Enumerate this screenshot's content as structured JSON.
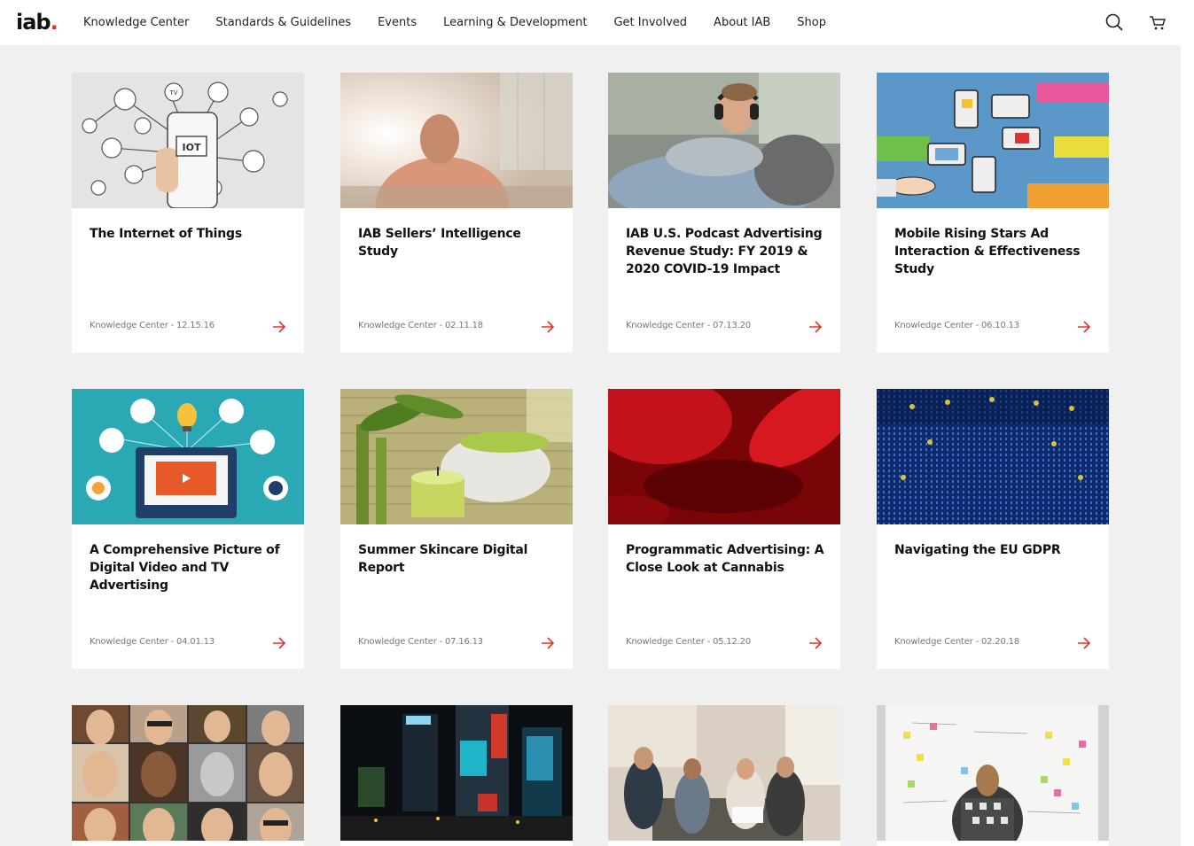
{
  "header": {
    "logo_text": "iab",
    "logo_dot": ".",
    "nav": [
      "Knowledge Center",
      "Standards & Guidelines",
      "Events",
      "Learning & Development",
      "Get Involved",
      "About IAB",
      "Shop"
    ],
    "icons": [
      "search-icon",
      "cart-icon"
    ]
  },
  "colors": {
    "accent": "#e5332a",
    "background": "#f0f0f0",
    "text": "#111111",
    "meta": "#777777"
  },
  "cards": [
    {
      "title": "The Internet of Things",
      "meta": "Knowledge Center - 12.15.16"
    },
    {
      "title": "IAB Sellers’ Intelligence Study",
      "meta": "Knowledge Center - 02.11.18"
    },
    {
      "title": "IAB U.S. Podcast Advertising Revenue Study: FY 2019 & 2020 COVID-19 Impact",
      "meta": "Knowledge Center - 07.13.20"
    },
    {
      "title": "Mobile Rising Stars Ad Interaction & Effectiveness Study",
      "meta": "Knowledge Center - 06.10.13"
    },
    {
      "title": "A Comprehensive Picture of Digital Video and TV Advertising",
      "meta": "Knowledge Center - 04.01.13"
    },
    {
      "title": "Summer Skincare Digital Report",
      "meta": "Knowledge Center - 07.16.13"
    },
    {
      "title": "Programmatic Advertising: A Close Look at Cannabis",
      "meta": "Knowledge Center - 05.12.20"
    },
    {
      "title": "Navigating the EU GDPR",
      "meta": "Knowledge Center - 02.20.18"
    },
    {
      "title": "",
      "meta": ""
    },
    {
      "title": "",
      "meta": ""
    },
    {
      "title": "",
      "meta": ""
    },
    {
      "title": "",
      "meta": ""
    }
  ],
  "image_labels": {
    "iot": "IOT",
    "tv": "TV"
  }
}
